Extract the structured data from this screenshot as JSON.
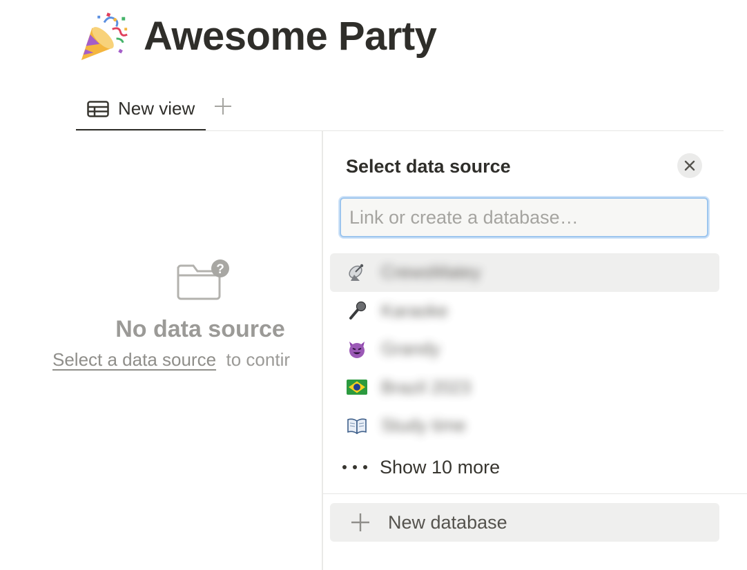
{
  "page": {
    "title": "Awesome Party",
    "title_icon": "party-popper-icon"
  },
  "tabs": [
    {
      "label": "New view",
      "icon": "table-icon",
      "active": true
    }
  ],
  "add_view_icon": "plus-icon",
  "empty_state": {
    "icon": "folder-question-icon",
    "title": "No data source",
    "link_text": "Select a data source",
    "suffix_text": "to contir"
  },
  "panel": {
    "title": "Select data source",
    "close_icon": "close-icon",
    "search_placeholder": "Link or create a database…",
    "items": [
      {
        "icon": "satellite-antenna-icon",
        "name": "CrewsMatey",
        "blurred": true,
        "active": true
      },
      {
        "icon": "microphone-icon",
        "name": "Karaoke",
        "blurred": true,
        "active": false
      },
      {
        "icon": "smiling-devil-icon",
        "name": "Grandy",
        "blurred": true,
        "active": false
      },
      {
        "icon": "brazil-flag-icon",
        "name": "Brazil 2023",
        "blurred": true,
        "active": false
      },
      {
        "icon": "open-book-icon",
        "name": "Study time",
        "blurred": true,
        "active": false
      }
    ],
    "show_more_label": "Show 10 more",
    "new_database_label": "New database"
  },
  "colors": {
    "text_primary": "#2f2e2a",
    "text_muted": "#9b9a97",
    "focus_border": "#9cc5ee",
    "hover_bg": "#efefee"
  }
}
